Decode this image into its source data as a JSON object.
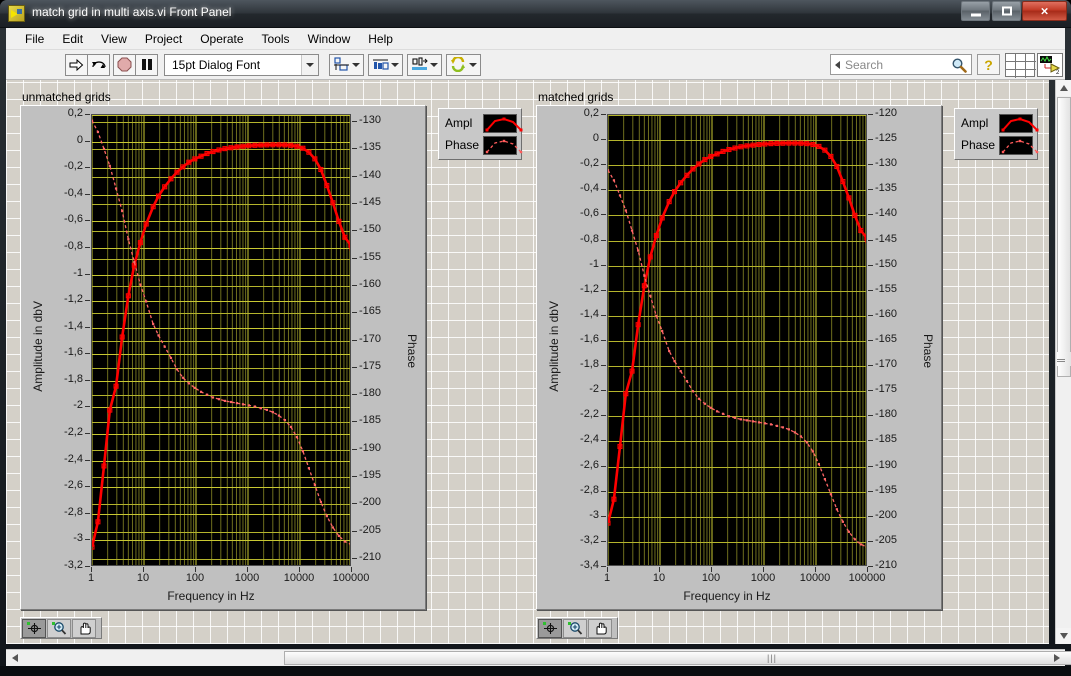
{
  "window": {
    "title": "match grid in multi axis.vi Front Panel",
    "app_icon": "labview-vi-icon",
    "buttons": {
      "minimize": "minimize-icon",
      "maximize": "maximize-icon",
      "close": "×"
    }
  },
  "menubar": {
    "items": [
      "File",
      "Edit",
      "View",
      "Project",
      "Operate",
      "Tools",
      "Window",
      "Help"
    ]
  },
  "toolbar": {
    "run_label": "run-arrow-icon",
    "run_continuous_label": "run-continuously-icon",
    "abort_label": "abort-execution-icon",
    "pause_label": "pause-icon",
    "font_value": "15pt Dialog Font",
    "align_label": "align-objects-icon",
    "distribute_label": "distribute-objects-icon",
    "resize_label": "resize-objects-icon",
    "reorder_label": "reorder-icon",
    "search_placeholder": "Search",
    "help_label": "?",
    "ni_badge": "2"
  },
  "graphs": [
    {
      "name": "unmatched grids",
      "ylabel_left": "Amplitude in dbV",
      "ylabel_right": "Phase",
      "xlabel": "Frequency in Hz",
      "y_left_ticks": [
        "0,2",
        "0",
        "-0,2",
        "-0,4",
        "-0,6",
        "-0,8",
        "-1",
        "-1,2",
        "-1,4",
        "-1,6",
        "-1,8",
        "-2",
        "-2,2",
        "-2,4",
        "-2,6",
        "-2,8",
        "-3",
        "-3,2"
      ],
      "y_right_ticks": [
        "-130",
        "-135",
        "-140",
        "-145",
        "-150",
        "-155",
        "-160",
        "-165",
        "-170",
        "-175",
        "-180",
        "-185",
        "-190",
        "-195",
        "-200",
        "-205",
        "-210"
      ],
      "x_ticks": [
        "1",
        "10",
        "100",
        "1000",
        "10000",
        "100000"
      ],
      "legend": [
        {
          "label": "Ampl",
          "style": "solid-line-marker"
        },
        {
          "label": "Phase",
          "style": "dashed-line-marker"
        }
      ],
      "palette": [
        "cursor-move-tool",
        "zoom-tool",
        "pan-tool"
      ]
    },
    {
      "name": "matched grids",
      "ylabel_left": "Amplitude in dbV",
      "ylabel_right": "Phase",
      "xlabel": "Frequency in Hz",
      "y_left_ticks": [
        "0,2",
        "0",
        "-0,2",
        "-0,4",
        "-0,6",
        "-0,8",
        "-1",
        "-1,2",
        "-1,4",
        "-1,6",
        "-1,8",
        "-2",
        "-2,2",
        "-2,4",
        "-2,6",
        "-2,8",
        "-3",
        "-3,2",
        "-3,4"
      ],
      "y_right_ticks": [
        "-120",
        "-125",
        "-130",
        "-135",
        "-140",
        "-145",
        "-150",
        "-155",
        "-160",
        "-165",
        "-170",
        "-175",
        "-180",
        "-185",
        "-190",
        "-195",
        "-200",
        "-205",
        "-210"
      ],
      "x_ticks": [
        "1",
        "10",
        "100",
        "1000",
        "10000",
        "100000"
      ],
      "legend": [
        {
          "label": "Ampl",
          "style": "solid-line-marker"
        },
        {
          "label": "Phase",
          "style": "dashed-line-marker"
        }
      ],
      "palette": [
        "cursor-move-tool",
        "zoom-tool",
        "pan-tool"
      ]
    }
  ],
  "chart_data": [
    {
      "type": "line",
      "title": "unmatched grids",
      "xlabel": "Frequency in Hz",
      "ylabel": "Amplitude in dbV",
      "ylabel2": "Phase",
      "xscale": "log",
      "xlim": [
        1,
        100000
      ],
      "ylim": [
        -3.2,
        0.2
      ],
      "ylim2": [
        -210,
        -130
      ],
      "grid": true,
      "legend_position": "outside-right-top",
      "series": [
        {
          "name": "Ampl",
          "axis": "left",
          "style": "solid",
          "color": "#ff0000",
          "x": [
            1,
            1.3,
            1.7,
            2.2,
            2.9,
            3.8,
            5,
            6.5,
            8.5,
            11,
            15,
            19,
            25,
            33,
            43,
            56,
            73,
            95,
            125,
            163,
            212,
            277,
            360,
            470,
            613,
            800,
            1040,
            1360,
            1770,
            2310,
            3010,
            3930,
            5120,
            6680,
            8710,
            11360,
            14820,
            19330,
            25210,
            32880,
            42890,
            55940,
            72960,
            95160,
            100000
          ],
          "y": [
            -3.05,
            -2.86,
            -2.44,
            -2.02,
            -1.84,
            -1.47,
            -1.16,
            -0.93,
            -0.76,
            -0.62,
            -0.49,
            -0.41,
            -0.34,
            -0.28,
            -0.23,
            -0.19,
            -0.155,
            -0.13,
            -0.11,
            -0.09,
            -0.075,
            -0.063,
            -0.053,
            -0.046,
            -0.04,
            -0.035,
            -0.031,
            -0.028,
            -0.026,
            -0.025,
            -0.024,
            -0.024,
            -0.025,
            -0.028,
            -0.035,
            -0.05,
            -0.08,
            -0.13,
            -0.21,
            -0.33,
            -0.46,
            -0.6,
            -0.72,
            -0.78,
            -0.8
          ]
        },
        {
          "name": "Phase",
          "axis": "right",
          "style": "dashed",
          "color": "#ff6666",
          "x": [
            1,
            1.3,
            1.7,
            2.2,
            2.9,
            3.8,
            5,
            6.5,
            8.5,
            11,
            15,
            19,
            25,
            33,
            43,
            56,
            73,
            95,
            125,
            163,
            212,
            277,
            360,
            470,
            613,
            800,
            1040,
            1360,
            1770,
            2310,
            3010,
            3930,
            5120,
            6680,
            8710,
            11360,
            14820,
            19330,
            25210,
            32880,
            42890,
            55940,
            72960,
            95160,
            100000
          ],
          "y": [
            -131,
            -133,
            -136,
            -139,
            -143,
            -147,
            -152,
            -156,
            -160,
            -163,
            -167,
            -169,
            -171,
            -173,
            -175,
            -176.5,
            -177.5,
            -178.3,
            -179,
            -179.5,
            -180,
            -180.3,
            -180.6,
            -180.8,
            -181,
            -181.2,
            -181.4,
            -181.6,
            -181.9,
            -182.2,
            -182.6,
            -183.2,
            -184,
            -185.2,
            -187,
            -189.5,
            -192.5,
            -195.5,
            -198.5,
            -201,
            -203,
            -204.5,
            -205.5,
            -206,
            -206.2
          ]
        }
      ]
    },
    {
      "type": "line",
      "title": "matched grids",
      "xlabel": "Frequency in Hz",
      "ylabel": "Amplitude in dbV",
      "ylabel2": "Phase",
      "xscale": "log",
      "xlim": [
        1,
        100000
      ],
      "ylim": [
        -3.4,
        0.2
      ],
      "ylim2": [
        -210,
        -120
      ],
      "grid": true,
      "legend_position": "outside-right-top",
      "series": [
        {
          "name": "Ampl",
          "axis": "left",
          "style": "solid",
          "color": "#ff0000",
          "x": [
            1,
            1.3,
            1.7,
            2.2,
            2.9,
            3.8,
            5,
            6.5,
            8.5,
            11,
            15,
            19,
            25,
            33,
            43,
            56,
            73,
            95,
            125,
            163,
            212,
            277,
            360,
            470,
            613,
            800,
            1040,
            1360,
            1770,
            2310,
            3010,
            3930,
            5120,
            6680,
            8710,
            11360,
            14820,
            19330,
            25210,
            32880,
            42890,
            55940,
            72960,
            95160,
            100000
          ],
          "y": [
            -3.05,
            -2.86,
            -2.44,
            -2.02,
            -1.84,
            -1.47,
            -1.16,
            -0.93,
            -0.76,
            -0.62,
            -0.49,
            -0.41,
            -0.34,
            -0.28,
            -0.23,
            -0.19,
            -0.155,
            -0.13,
            -0.11,
            -0.09,
            -0.075,
            -0.063,
            -0.053,
            -0.046,
            -0.04,
            -0.035,
            -0.031,
            -0.028,
            -0.026,
            -0.025,
            -0.024,
            -0.024,
            -0.025,
            -0.028,
            -0.035,
            -0.05,
            -0.08,
            -0.13,
            -0.21,
            -0.33,
            -0.46,
            -0.6,
            -0.72,
            -0.78,
            -0.8
          ]
        },
        {
          "name": "Phase",
          "axis": "right",
          "style": "dashed",
          "color": "#ff6666",
          "x": [
            1,
            1.3,
            1.7,
            2.2,
            2.9,
            3.8,
            5,
            6.5,
            8.5,
            11,
            15,
            19,
            25,
            33,
            43,
            56,
            73,
            95,
            125,
            163,
            212,
            277,
            360,
            470,
            613,
            800,
            1040,
            1360,
            1770,
            2310,
            3010,
            3930,
            5120,
            6680,
            8710,
            11360,
            14820,
            19330,
            25210,
            32880,
            42890,
            55940,
            72960,
            95160,
            100000
          ],
          "y": [
            -131,
            -133,
            -136,
            -139,
            -143,
            -147,
            -152,
            -156,
            -160,
            -163,
            -167,
            -169,
            -171,
            -173,
            -175,
            -176.5,
            -177.5,
            -178.3,
            -179,
            -179.5,
            -180,
            -180.3,
            -180.6,
            -180.8,
            -181,
            -181.2,
            -181.4,
            -181.6,
            -181.9,
            -182.2,
            -182.6,
            -183.2,
            -184,
            -185.2,
            -187,
            -189.5,
            -192.5,
            -195.5,
            -198.5,
            -201,
            -203,
            -204.5,
            -205.5,
            -206,
            -206.2
          ]
        }
      ]
    }
  ]
}
